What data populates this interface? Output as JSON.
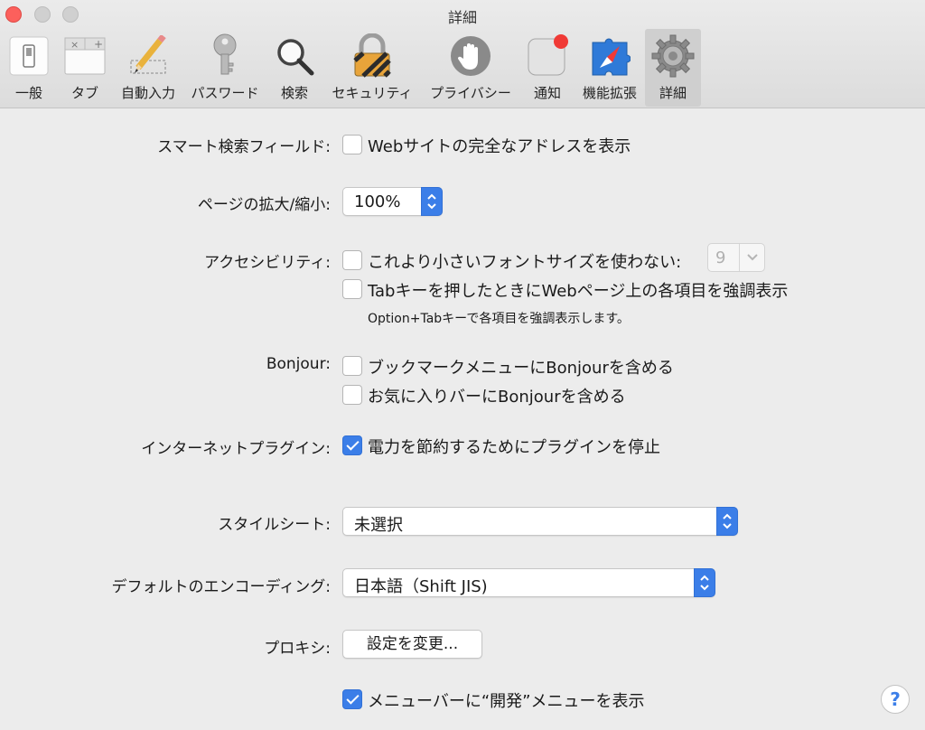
{
  "window": {
    "title": "詳細"
  },
  "toolbar": {
    "tabs": [
      {
        "label": "一般",
        "icon": "general-switch-icon"
      },
      {
        "label": "タブ",
        "icon": "tabs-icon"
      },
      {
        "label": "自動入力",
        "icon": "pencil-icon"
      },
      {
        "label": "パスワード",
        "icon": "key-icon"
      },
      {
        "label": "検索",
        "icon": "magnifier-icon"
      },
      {
        "label": "セキュリティ",
        "icon": "lock-icon"
      },
      {
        "label": "プライバシー",
        "icon": "hand-icon"
      },
      {
        "label": "通知",
        "icon": "notification-icon"
      },
      {
        "label": "機能拡張",
        "icon": "extensions-compass-icon"
      },
      {
        "label": "詳細",
        "icon": "gear-icon",
        "selected": true
      }
    ],
    "tab_x_marks": {
      "close": "×",
      "add": "+"
    }
  },
  "smart_search": {
    "label": "スマート検索フィールド:",
    "option": "Webサイトの完全なアドレスを表示",
    "checked": false
  },
  "page_zoom": {
    "label": "ページの拡大/縮小:",
    "value": "100%"
  },
  "accessibility": {
    "label": "アクセシビリティ:",
    "min_font_option": "これより小さいフォントサイズを使わない:",
    "min_font_checked": false,
    "min_font_value": "9",
    "tab_option": "Tabキーを押したときにWebページ上の各項目を強調表示",
    "tab_checked": false,
    "tab_note": "Option+Tabキーで各項目を強調表示します。"
  },
  "bonjour": {
    "label": "Bonjour:",
    "bookmarks_option": "ブックマークメニューにBonjourを含める",
    "bookmarks_checked": false,
    "favorites_option": "お気に入りバーにBonjourを含める",
    "favorites_checked": false
  },
  "plugins": {
    "label": "インターネットプラグイン:",
    "option": "電力を節約するためにプラグインを停止",
    "checked": true
  },
  "style_sheet": {
    "label": "スタイルシート:",
    "value": "未選択"
  },
  "encoding": {
    "label": "デフォルトのエンコーディング:",
    "value": "日本語（Shift JIS)"
  },
  "proxies": {
    "label": "プロキシ:",
    "button": "設定を変更..."
  },
  "develop_menu": {
    "option": "メニューバーに“開発”メニューを表示",
    "checked": true
  },
  "help": {
    "label": "?"
  },
  "colors": {
    "accent": "#3b7ee8",
    "close": "#fc605c",
    "background": "#ececec"
  }
}
